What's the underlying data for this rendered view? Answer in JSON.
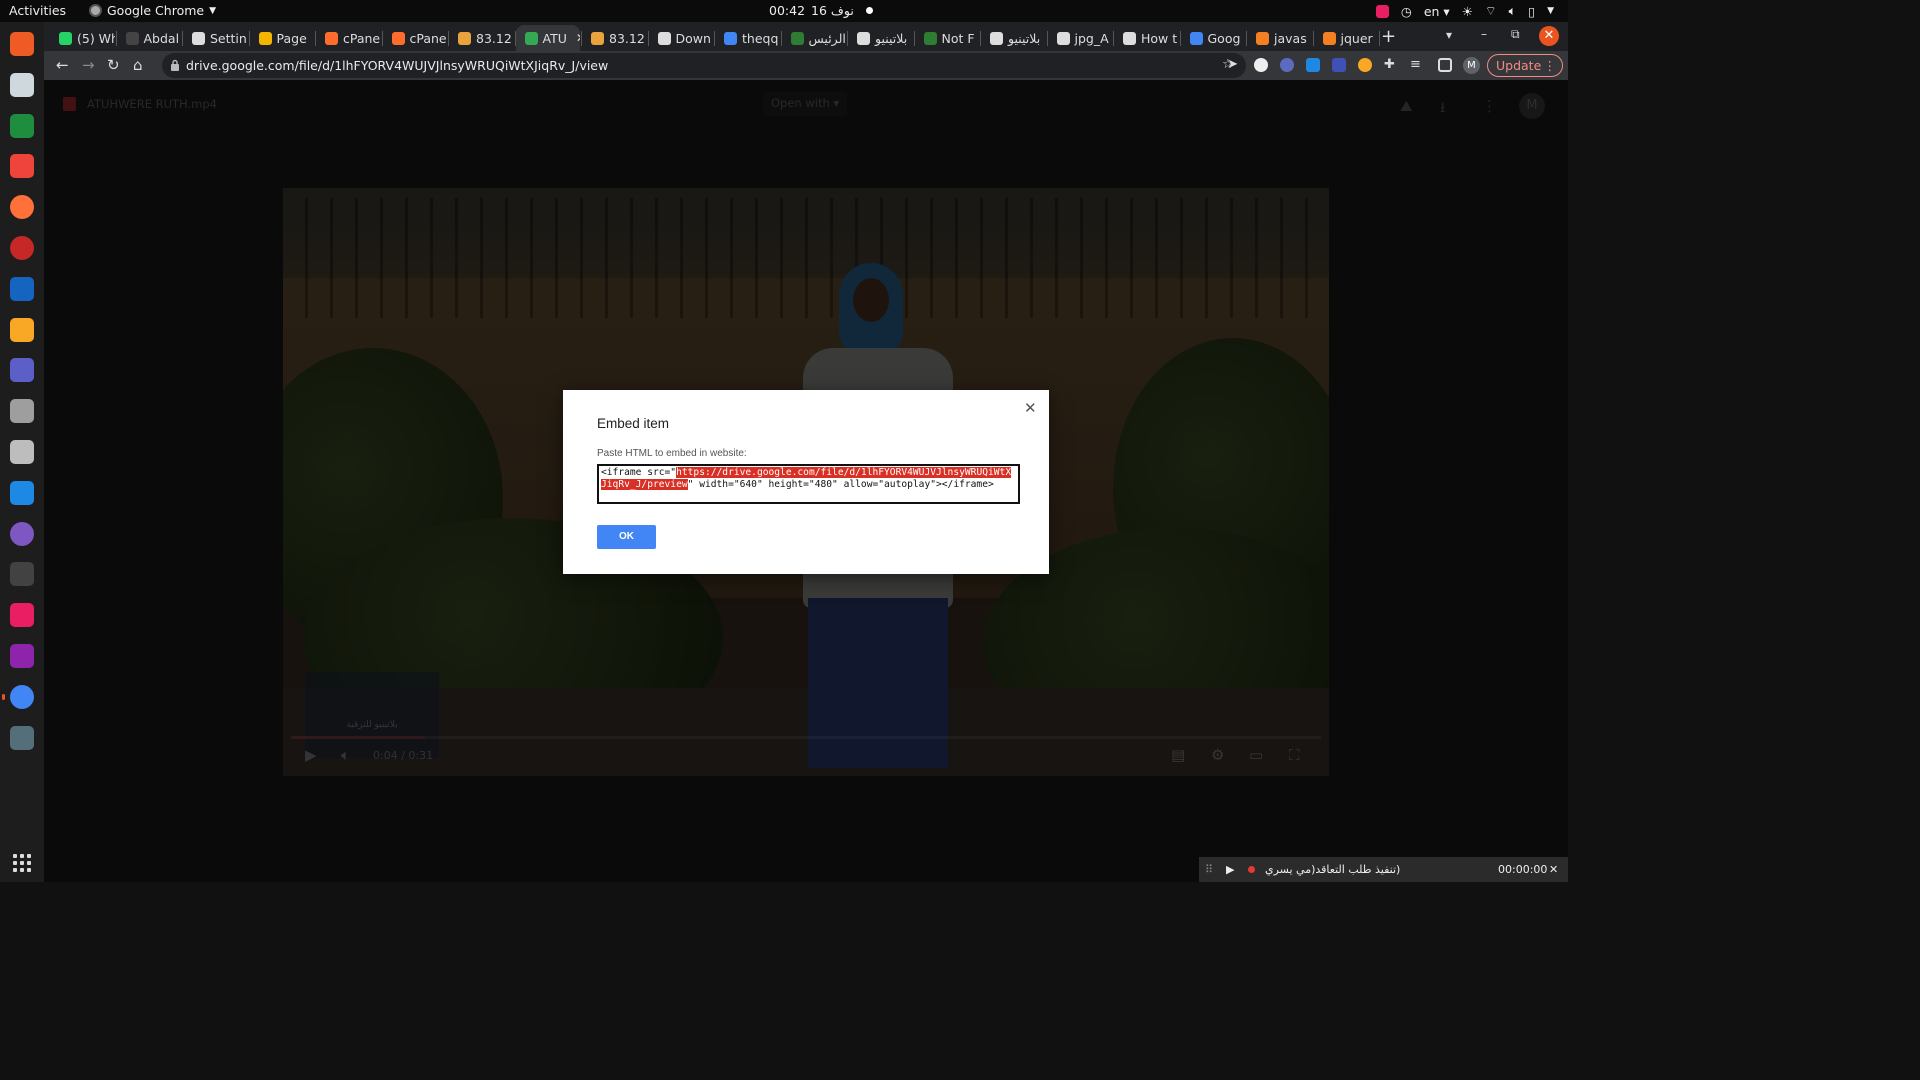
{
  "topbar": {
    "activities": "Activities",
    "app_name": "Google Chrome",
    "clock_time": "00:42",
    "clock_date": "نوف 16",
    "lang": "en"
  },
  "tabs": [
    {
      "label": "(5) Wh",
      "favicon": "whatsapp-icon",
      "color": "#25d366"
    },
    {
      "label": "Abdal",
      "favicon": "blank-icon",
      "color": "#444444"
    },
    {
      "label": "Settin",
      "favicon": "gear-icon",
      "color": "#dddddd"
    },
    {
      "label": "Page ",
      "favicon": "drive-icon",
      "color": "#f4b400"
    },
    {
      "label": "cPane",
      "favicon": "cpanel-icon",
      "color": "#ff6c2c"
    },
    {
      "label": "cPane",
      "favicon": "cpanel-icon",
      "color": "#ff6c2c"
    },
    {
      "label": "83.12",
      "favicon": "server-icon",
      "color": "#e8a33d"
    },
    {
      "label": "ATU",
      "favicon": "drive-icon",
      "color": "#34a853",
      "active": true
    },
    {
      "label": "83.12",
      "favicon": "server-icon",
      "color": "#e8a33d"
    },
    {
      "label": "Down",
      "favicon": "download-icon",
      "color": "#dddddd"
    },
    {
      "label": "theqq",
      "favicon": "docs-icon",
      "color": "#4285f4"
    },
    {
      "label": "الرئيس",
      "favicon": "site-icon",
      "color": "#2e7d32"
    },
    {
      "label": "بلاتينيو",
      "favicon": "globe-icon",
      "color": "#dddddd"
    },
    {
      "label": "Not F",
      "favicon": "site-icon",
      "color": "#2e7d32"
    },
    {
      "label": "بلاتينيو",
      "favicon": "globe-icon",
      "color": "#dddddd"
    },
    {
      "label": "jpg_A",
      "favicon": "globe-icon",
      "color": "#dddddd"
    },
    {
      "label": "How t",
      "favicon": "globe-icon",
      "color": "#dddddd"
    },
    {
      "label": "Goog",
      "favicon": "translate-icon",
      "color": "#4285f4"
    },
    {
      "label": "javas",
      "favicon": "stackoverflow-icon",
      "color": "#f48024"
    },
    {
      "label": "jquer",
      "favicon": "stackoverflow-icon",
      "color": "#f48024"
    }
  ],
  "toolbar": {
    "url": "drive.google.com/file/d/1lhFYORV4WUJVJlnsyWRUQiWtXJiqRv_J/view",
    "update_label": "Update",
    "profile_initial": "M"
  },
  "drive": {
    "file_name": "ATUHWERE RUTH.mp4",
    "open_with": "Open with",
    "avatar_initial": "M",
    "video": {
      "time": "0:04 / 0:31",
      "progress_fraction": 0.13,
      "watermark_text": "بلاتينيو للترقية"
    }
  },
  "modal": {
    "title": "Embed item",
    "label": "Paste HTML to embed in website:",
    "code_before": "<iframe src=\"",
    "code_selected": "https://drive.google.com/file/d/1lhFYORV4WUJVJlnsyWRUQiWtXJiqRv_J/preview",
    "code_after": "\" width=\"640\" height=\"480\" allow=\"autoplay\"></iframe>",
    "ok_label": "OK"
  },
  "recording": {
    "title": "(تنفيذ طلب التعاقد(مي يسري",
    "time": "00:00:00"
  },
  "dock_apps": [
    {
      "name": "postman-icon",
      "color": "#ef5b25"
    },
    {
      "name": "remmina-icon",
      "color": "#cfd8dc"
    },
    {
      "name": "sheets-icon",
      "color": "#1e8e3e"
    },
    {
      "name": "anydesk-icon",
      "color": "#ef443b"
    },
    {
      "name": "firefox-icon",
      "color": "#ff7139"
    },
    {
      "name": "todo-icon",
      "color": "#c62828"
    },
    {
      "name": "text-editor-icon",
      "color": "#1565c0"
    },
    {
      "name": "calculator-icon",
      "color": "#f9a825"
    },
    {
      "name": "teams-icon",
      "color": "#5b5fc7"
    },
    {
      "name": "archive-icon",
      "color": "#9e9e9e"
    },
    {
      "name": "files-icon",
      "color": "#bdbdbd"
    },
    {
      "name": "writer-icon",
      "color": "#1e88e5"
    },
    {
      "name": "network-icon",
      "color": "#7e57c2"
    },
    {
      "name": "terminal-icon",
      "color": "#424242"
    },
    {
      "name": "jetbrains-icon",
      "color": "#e91e63"
    },
    {
      "name": "phpstorm-icon",
      "color": "#8e24aa"
    },
    {
      "name": "chrome-icon",
      "color": "#4285f4"
    },
    {
      "name": "mouse-icon",
      "color": "#546e7a"
    }
  ]
}
